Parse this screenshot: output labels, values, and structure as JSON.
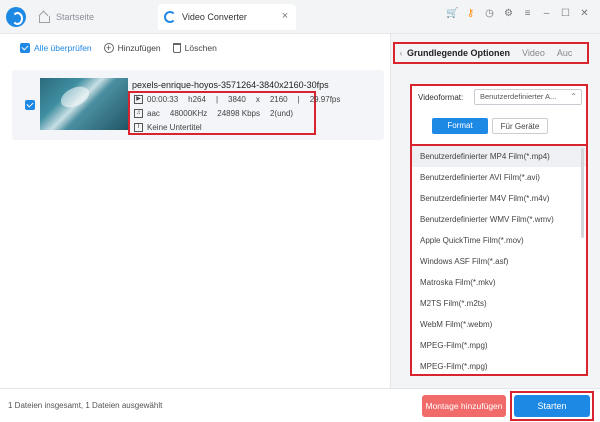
{
  "titlebar": {
    "home_tab": "Startseite",
    "converter_tab": "Video Converter",
    "close_glyph": "×"
  },
  "toolbar": {
    "select_all": "Alle überprüfen",
    "add": "Hinzufügen",
    "delete": "Löschen"
  },
  "file": {
    "name": "pexels-enrique-hoyos-3571264-3840x2160-30fps",
    "duration": "00:00:33",
    "codec": "h264",
    "width": "3840",
    "times": "x",
    "height": "2160",
    "fps": "29.97fps",
    "audio_codec": "aac",
    "sample_rate": "48000KHz",
    "bitrate": "24898 Kbps",
    "channels": "2(und)",
    "subtitle": "Keine Untertitel",
    "sep": "|"
  },
  "right": {
    "tabs": [
      "Grundlegende Optionen",
      "Video",
      "Auc"
    ],
    "video_format_label": "Videoformat:",
    "video_format_value": "Benutzerdefinierter A...",
    "seg_format": "Format",
    "seg_devices": "Für Geräte",
    "formats": [
      "Benutzerdefinierter MP4 Film(*.mp4)",
      "Benutzerdefinierter AVI Film(*.avi)",
      "Benutzerdefinierter M4V Film(*.m4v)",
      "Benutzerdefinierter WMV Film(*.wmv)",
      "Apple QuickTime Film(*.mov)",
      "Windows ASF Film(*.asf)",
      "Matroska Film(*.mkv)",
      "M2TS Film(*.m2ts)",
      "WebM Film(*.webm)",
      "MPEG-Film(*.mpg)",
      "MPEG-Film(*.mpg)"
    ]
  },
  "bottom": {
    "status": "1 Dateien insgesamt, 1 Dateien ausgewählt",
    "montage": "Montage hinzufügen",
    "start": "Starten"
  },
  "colors": {
    "accent": "#1e88e5",
    "highlight_border": "#d9232e",
    "montage": "#f26b6b"
  }
}
